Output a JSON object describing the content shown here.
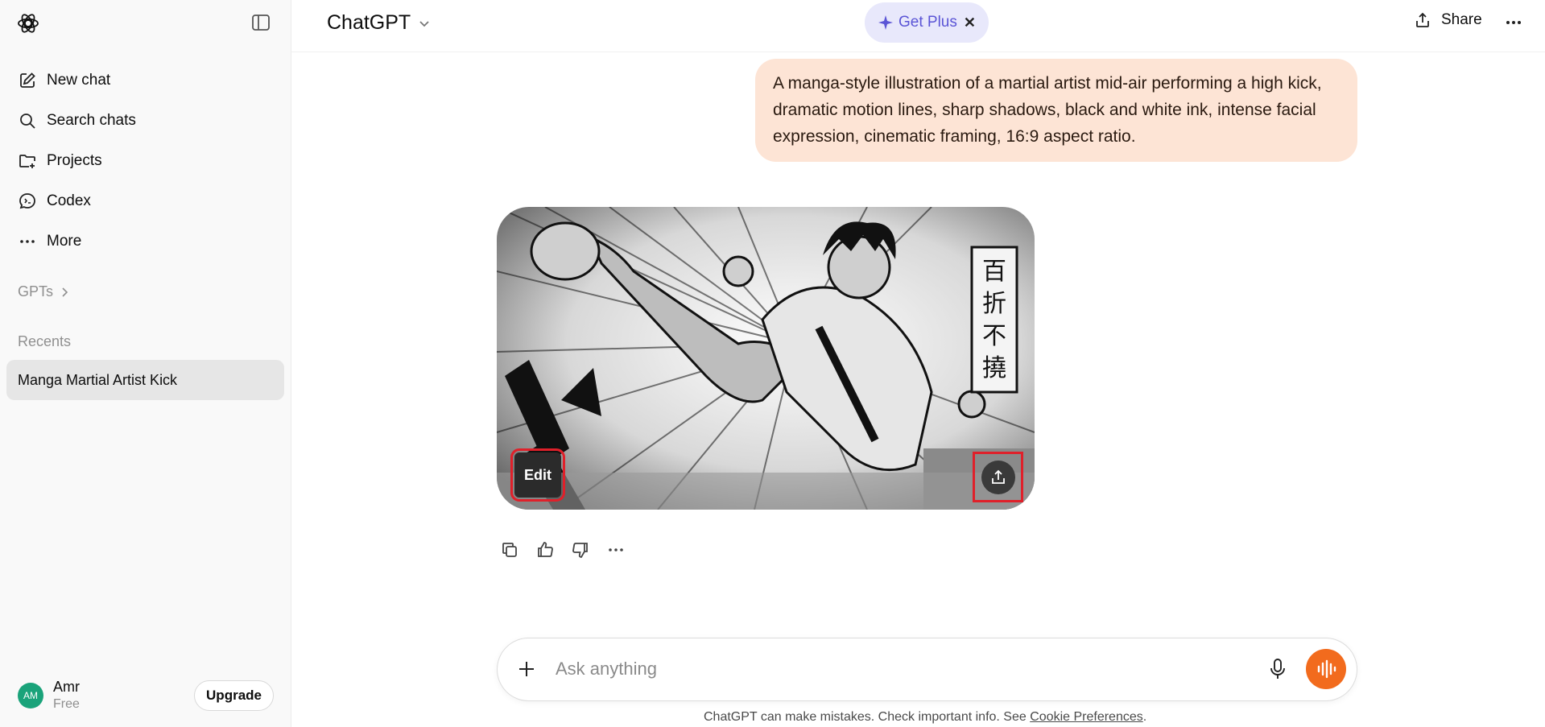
{
  "sidebar": {
    "nav": [
      {
        "label": "New chat",
        "icon": "pencil-square-icon"
      },
      {
        "label": "Search chats",
        "icon": "search-icon"
      },
      {
        "label": "Projects",
        "icon": "folder-plus-icon"
      },
      {
        "label": "Codex",
        "icon": "codex-icon"
      },
      {
        "label": "More",
        "icon": "more-horizontal-icon"
      }
    ],
    "gpts_label": "GPTs",
    "recents_label": "Recents",
    "recents": [
      {
        "label": "Manga Martial Artist Kick"
      }
    ],
    "user": {
      "initials": "AM",
      "name": "Amr",
      "plan": "Free"
    },
    "upgrade_label": "Upgrade"
  },
  "header": {
    "model": "ChatGPT",
    "get_plus_label": "Get Plus",
    "share_label": "Share"
  },
  "conversation": {
    "user_message": "A manga-style illustration of a martial artist mid-air performing a high kick, dramatic motion lines, sharp shadows, black and white ink, intense facial expression, cinematic framing, 16:9 aspect ratio.",
    "image": {
      "edit_label": "Edit",
      "banner_text": "百折不撓"
    }
  },
  "composer": {
    "placeholder": "Ask anything"
  },
  "footer": {
    "disclaimer": "ChatGPT can make mistakes. Check important info. See ",
    "link": "Cookie Preferences",
    "end": "."
  },
  "colors": {
    "accent_orange": "#f26b1d",
    "user_bubble": "#fde4d5",
    "get_plus_bg": "#e8e8fb",
    "highlight_red": "#e0202a"
  }
}
